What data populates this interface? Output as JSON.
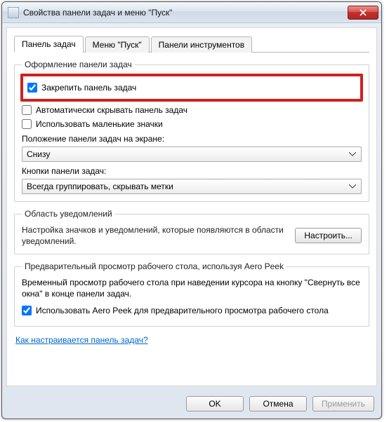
{
  "window": {
    "title": "Свойства панели задач и меню \"Пуск\""
  },
  "tabs": {
    "taskbar": "Панель задач",
    "startmenu": "Меню \"Пуск\"",
    "toolbars": "Панели инструментов"
  },
  "appearance": {
    "legend": "Оформление панели задач",
    "lock": "Закрепить панель задач",
    "autohide": "Автоматически скрывать панель задач",
    "smallicons": "Использовать маленькие значки",
    "position_label": "Положение панели задач на экране:",
    "position_value": "Снизу",
    "buttons_label": "Кнопки панели задач:",
    "buttons_value": "Всегда группировать, скрывать метки"
  },
  "notifications": {
    "legend": "Область уведомлений",
    "desc": "Настройка значков и уведомлений, которые появляются в области уведомлений.",
    "configure": "Настроить..."
  },
  "aero": {
    "legend": "Предварительный просмотр рабочего стола, используя Aero Peek",
    "desc": "Временный просмотр рабочего стола при наведении курсора на кнопку \"Свернуть все окна\" в конце панели задач.",
    "use_peek": "Использовать Aero Peek для предварительного просмотра рабочего стола"
  },
  "help_link": "Как настраивается панель задач?",
  "footer": {
    "ok": "OK",
    "cancel": "Отмена",
    "apply": "Применить"
  }
}
